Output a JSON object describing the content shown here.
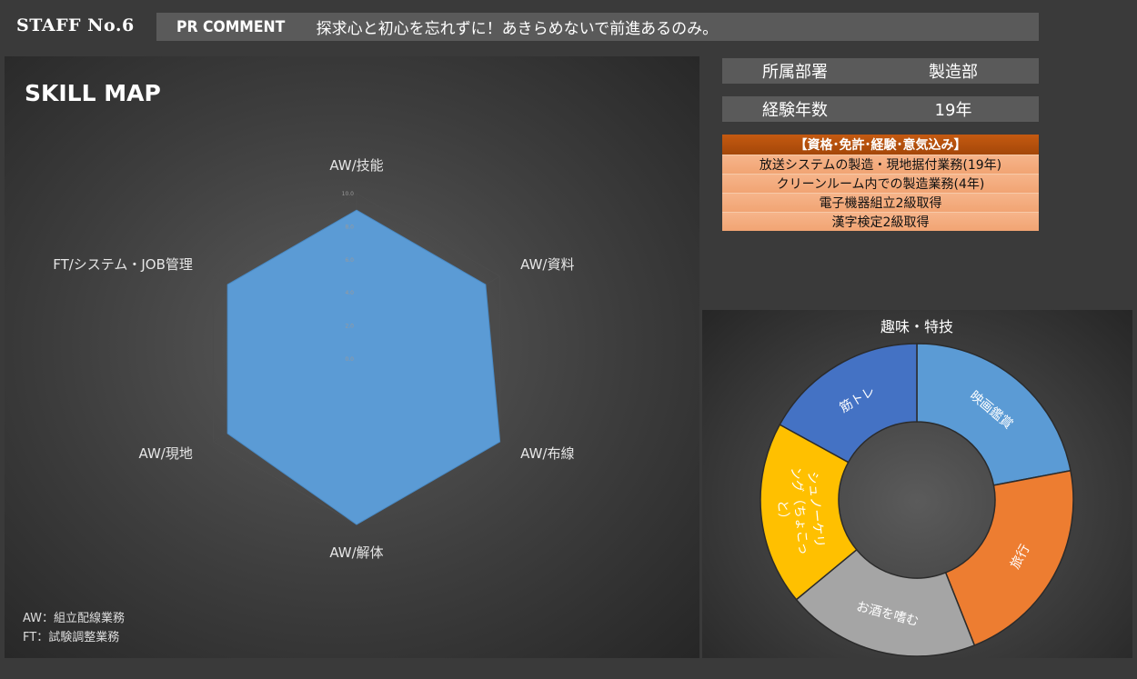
{
  "header": {
    "staff_no": "STAFF No.6",
    "pr_label": "PR COMMENT",
    "pr_text": "探求心と初心を忘れずに！あきらめないで前進あるのみ。"
  },
  "skill_map": {
    "title": "SKILL MAP",
    "notes": [
      "AW：組立配線業務",
      "FT：試験調整業務"
    ]
  },
  "profile": {
    "department_label": "所属部署",
    "department_value": "製造部",
    "years_label": "経験年数",
    "years_value": "19年"
  },
  "qualifications": {
    "header": "【資格･免許･経験･意気込み】",
    "items": [
      "放送システムの製造・現地据付業務(19年)",
      "クリーンルーム内での製造業務(4年)",
      "電子機器組立2級取得",
      "漢字検定2級取得"
    ]
  },
  "colors": {
    "radar_fill": "#5b9bd5",
    "movie": "#5b9bd5",
    "travel": "#ed7d31",
    "sake": "#a5a5a5",
    "snorkel": "#ffc000",
    "gym": "#4472c4"
  },
  "chart_data": [
    {
      "type": "radar",
      "title": "SKILL MAP",
      "categories": [
        "AW/技能",
        "AW/資料",
        "AW/布線",
        "AW/解体",
        "AW/現地",
        "FT/システム・JOB管理"
      ],
      "ticks": [
        "0.0",
        "2.0",
        "4.0",
        "6.0",
        "8.0",
        "10.0"
      ],
      "rmin": 0,
      "rmax": 10,
      "series": [
        {
          "values": [
            9,
            9,
            10,
            10,
            9,
            9
          ]
        }
      ],
      "grid": true
    },
    {
      "type": "pie",
      "subtype": "doughnut",
      "title": "趣味・特技",
      "slices": [
        {
          "label": "映画鑑賞",
          "value": 22,
          "color": "#5b9bd5"
        },
        {
          "label": "旅行",
          "value": 22,
          "color": "#ed7d31"
        },
        {
          "label": "お酒を嗜む",
          "value": 20,
          "color": "#a5a5a5"
        },
        {
          "label": "シュノーケリング（ちょこっと）",
          "label_lines": [
            "シュノーケリ",
            "ング（ちょこっ",
            "と）"
          ],
          "value": 19,
          "color": "#ffc000"
        },
        {
          "label": "筋トレ",
          "value": 17,
          "color": "#4472c4"
        }
      ]
    }
  ]
}
